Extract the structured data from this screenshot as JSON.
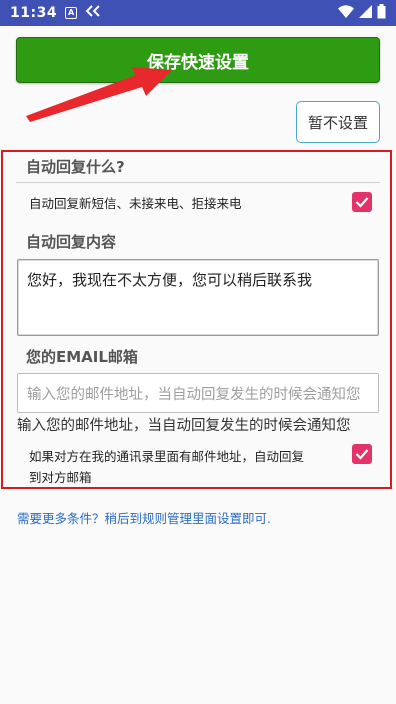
{
  "status_bar": {
    "time": "11:34",
    "a_badge": "A"
  },
  "save_button": {
    "label": "保存快速设置"
  },
  "skip_button": {
    "label": "暂不设置"
  },
  "auto_reply_section": {
    "title": "自动回复什么?",
    "option_label": "自动回复新短信、未接来电、拒接来电",
    "option_checked": true
  },
  "reply_content": {
    "title": "自动回复内容",
    "value": "您好，我现在不太方便，您可以稍后联系我"
  },
  "email": {
    "title": "您的EMAIL邮箱",
    "placeholder": "输入您的邮件地址，当自动回复发生的时候会通知您",
    "hint": "输入您的邮件地址，当自动回复发生的时候会通知您",
    "contact_option_line1": "如果对方在我的通讯录里面有邮件地址，自动回复",
    "contact_option_line2": "到对方邮箱",
    "contact_option_checked": true
  },
  "more_conditions_link": "需要更多条件？稍后到规则管理里面设置即可.",
  "colors": {
    "status_bar": "#3f51b5",
    "save_button": "#2e9b13",
    "highlight_border": "#d81b20",
    "checkbox": "#e2336b",
    "link": "#2b6cc4",
    "arrow": "#e8282c"
  }
}
